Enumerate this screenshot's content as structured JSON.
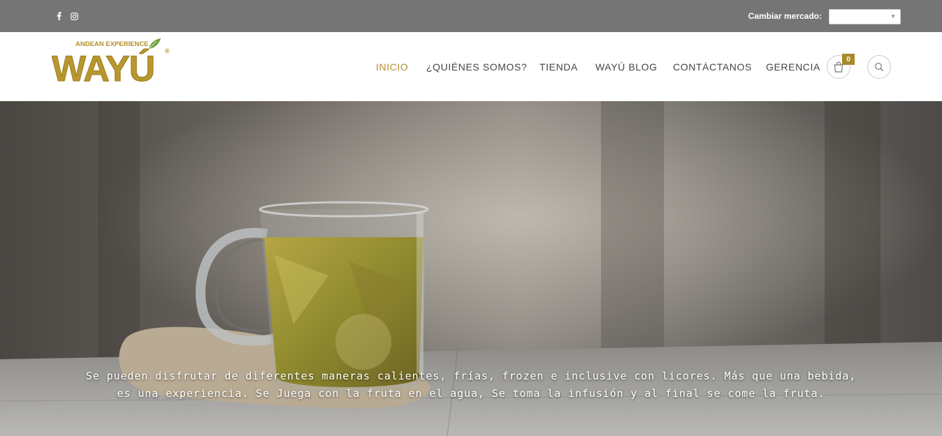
{
  "topbar": {
    "social": [
      {
        "icon": "facebook-icon"
      },
      {
        "icon": "instagram-icon"
      }
    ],
    "market_label": "Cambiar mercado:",
    "market_value": ""
  },
  "brand": {
    "tagline": "ANDEAN EXPERIENCE",
    "name": "WAYÚ",
    "registered": "®",
    "color": "#b28f2c"
  },
  "nav": {
    "items": [
      {
        "label": "INICIO",
        "active": true
      },
      {
        "label": "¿QUIÉNES SOMOS?",
        "active": false
      },
      {
        "label": "TIENDA",
        "active": false
      },
      {
        "label": "WAYÚ BLOG",
        "active": false
      },
      {
        "label": "CONTÁCTANOS",
        "active": false
      },
      {
        "label": "GERENCIA",
        "active": false
      }
    ],
    "cart_count": "0",
    "cart_icon": "shopping-bag-icon",
    "search_icon": "search-icon"
  },
  "hero": {
    "line1": "Se pueden disfrutar de diferentes maneras calientes, frías, frozen e inclusive con licores. Más que una bebida,",
    "line2": "es una experiencia. Se Juega con la fruta en el agua, Se toma la infusión y al final se come la fruta."
  }
}
